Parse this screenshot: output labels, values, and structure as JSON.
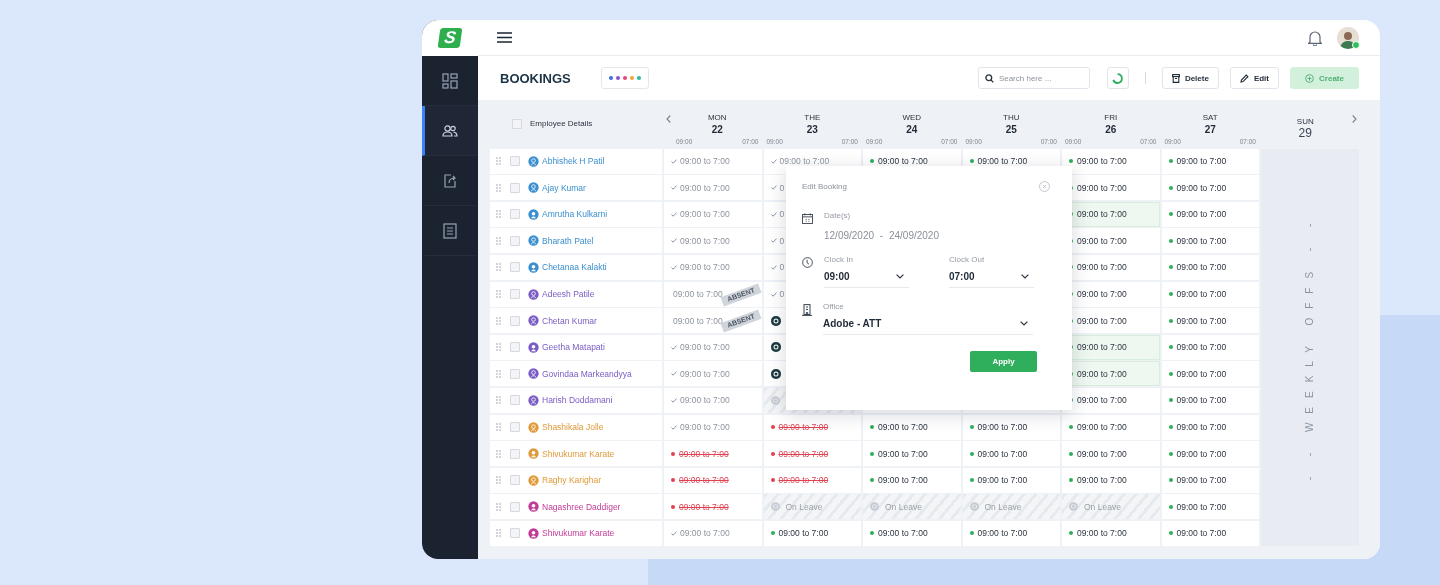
{
  "sidebar": {
    "logo": "S",
    "items": [
      {
        "selected": false
      },
      {
        "selected": true
      },
      {
        "selected": false
      },
      {
        "selected": false
      }
    ]
  },
  "user": {
    "online": true
  },
  "header": {
    "title": "BOOKINGS",
    "color_dots": [
      {
        "color": "#3d6fd8"
      },
      {
        "color": "#8b52d1"
      },
      {
        "color": "#e2487a"
      },
      {
        "color": "#f2a43a"
      },
      {
        "color": "#2cb6a3"
      }
    ],
    "search": {
      "placeholder": "Search here ..."
    },
    "buttons": [
      {
        "kind": "delete",
        "label": "Delete",
        "disabled": false
      },
      {
        "kind": "edit",
        "label": "Edit",
        "disabled": false
      },
      {
        "kind": "create",
        "label": "Create",
        "disabled": true
      }
    ]
  },
  "table": {
    "header": {
      "label": "Employee Details",
      "checked": false
    },
    "days": [
      {
        "name": "MON",
        "date": "22",
        "start": "09:00",
        "end": "07:00",
        "weekly_off": false
      },
      {
        "name": "THE",
        "date": "23",
        "start": "09:00",
        "end": "07:00",
        "weekly_off": false
      },
      {
        "name": "WED",
        "date": "24",
        "start": "09:00",
        "end": "07:00",
        "weekly_off": false
      },
      {
        "name": "THU",
        "date": "25",
        "start": "09:00",
        "end": "07:00",
        "weekly_off": false
      },
      {
        "name": "FRI",
        "date": "26",
        "start": "09:00",
        "end": "07:00",
        "weekly_off": false
      },
      {
        "name": "SAT",
        "date": "27",
        "start": "09:00",
        "end": "07:00",
        "weekly_off": false
      },
      {
        "name": "SUN",
        "date": "29",
        "weekly_off": true
      }
    ],
    "weekly_off_label": "- - WEEKLY OFFS - -",
    "employees": [
      {
        "name": "Abhishek H Patil",
        "color": "#3a8fd0",
        "kind": "outline",
        "checked": false,
        "cells": [
          {
            "kind": "done",
            "text": "09:00 to 7:00",
            "selected": false
          },
          {
            "kind": "done",
            "text": "09:00 to 7:00",
            "selected": false
          },
          {
            "kind": "scheduled",
            "text": "09:00 to 7:00",
            "selected": false
          },
          {
            "kind": "scheduled",
            "text": "09:00 to 7:00",
            "selected": false
          },
          {
            "kind": "scheduled",
            "text": "09:00 to 7:00",
            "selected": false
          },
          {
            "kind": "scheduled",
            "text": "09:00 to 7:00",
            "selected": false
          }
        ]
      },
      {
        "name": "Ajay Kumar",
        "color": "#3a8fd0",
        "kind": "outline",
        "checked": false,
        "cells": [
          {
            "kind": "done",
            "text": "09:00 to 7:00",
            "selected": false
          },
          {
            "kind": "done",
            "text": "0",
            "selected": false
          },
          {
            "kind": "covered"
          },
          {
            "kind": "covered"
          },
          {
            "kind": "scheduled",
            "text": "09:00 to 7:00",
            "selected": false
          },
          {
            "kind": "scheduled",
            "text": "09:00 to 7:00",
            "selected": false
          }
        ]
      },
      {
        "name": "Amrutha Kulkarni",
        "color": "#3a8fd0",
        "kind": "filled",
        "checked": false,
        "cells": [
          {
            "kind": "done",
            "text": "09:00 to 7:00",
            "selected": false
          },
          {
            "kind": "done",
            "text": "0",
            "selected": false
          },
          {
            "kind": "covered"
          },
          {
            "kind": "covered"
          },
          {
            "kind": "scheduled",
            "text": "09:00 to 7:00",
            "selected": true
          },
          {
            "kind": "scheduled",
            "text": "09:00 to 7:00",
            "selected": false
          }
        ]
      },
      {
        "name": "Bharath Patel",
        "color": "#3a8fd0",
        "kind": "outline",
        "checked": false,
        "cells": [
          {
            "kind": "done",
            "text": "09:00 to 7:00",
            "selected": false
          },
          {
            "kind": "done",
            "text": "0",
            "selected": false
          },
          {
            "kind": "covered"
          },
          {
            "kind": "covered"
          },
          {
            "kind": "scheduled",
            "text": "09:00 to 7:00",
            "selected": false
          },
          {
            "kind": "scheduled",
            "text": "09:00 to 7:00",
            "selected": false
          }
        ]
      },
      {
        "name": "Chetanaa Kalakti",
        "color": "#3a8fd0",
        "kind": "filled",
        "checked": false,
        "cells": [
          {
            "kind": "done",
            "text": "09:00 to 7:00",
            "selected": false
          },
          {
            "kind": "done",
            "text": "0",
            "selected": false
          },
          {
            "kind": "covered"
          },
          {
            "kind": "covered"
          },
          {
            "kind": "scheduled",
            "text": "09:00 to 7:00",
            "selected": false
          },
          {
            "kind": "scheduled",
            "text": "09:00 to 7:00",
            "selected": false
          }
        ]
      },
      {
        "name": "Adeesh Patile",
        "color": "#7b5cc6",
        "kind": "outline",
        "checked": false,
        "cells": [
          {
            "kind": "absent",
            "text": "09:00 to 7:00",
            "tag": "ABSENT",
            "selected": false
          },
          {
            "kind": "done",
            "text": "0",
            "selected": false
          },
          {
            "kind": "covered"
          },
          {
            "kind": "covered"
          },
          {
            "kind": "scheduled",
            "text": "09:00 to 7:00",
            "selected": false
          },
          {
            "kind": "scheduled",
            "text": "09:00 to 7:00",
            "selected": false
          }
        ]
      },
      {
        "name": "Chetan Kumar",
        "color": "#7b5cc6",
        "kind": "outline",
        "checked": false,
        "cells": [
          {
            "kind": "absent",
            "text": "09:00 to 7:00",
            "tag": "ABSENT",
            "selected": false
          },
          {
            "kind": "office",
            "selected": false
          },
          {
            "kind": "covered"
          },
          {
            "kind": "covered"
          },
          {
            "kind": "scheduled",
            "text": "09:00 to 7:00",
            "selected": false
          },
          {
            "kind": "scheduled",
            "text": "09:00 to 7:00",
            "selected": false
          }
        ]
      },
      {
        "name": "Geetha Matapati",
        "color": "#7b5cc6",
        "kind": "filled",
        "checked": false,
        "cells": [
          {
            "kind": "done",
            "text": "09:00 to 7:00",
            "selected": false
          },
          {
            "kind": "office",
            "selected": false
          },
          {
            "kind": "covered"
          },
          {
            "kind": "covered"
          },
          {
            "kind": "scheduled",
            "text": "09:00 to 7:00",
            "selected": true
          },
          {
            "kind": "scheduled",
            "text": "09:00 to 7:00",
            "selected": false
          }
        ]
      },
      {
        "name": "Govindaa Markeandyya",
        "color": "#7b5cc6",
        "kind": "outline",
        "checked": false,
        "cells": [
          {
            "kind": "done",
            "text": "09:00 to 7:00",
            "selected": false
          },
          {
            "kind": "office",
            "selected": false
          },
          {
            "kind": "covered"
          },
          {
            "kind": "covered"
          },
          {
            "kind": "scheduled",
            "text": "09:00 to 7:00",
            "selected": true
          },
          {
            "kind": "scheduled",
            "text": "09:00 to 7:00",
            "selected": false
          }
        ]
      },
      {
        "name": "Harish Doddamani",
        "color": "#7b5cc6",
        "kind": "outline",
        "checked": false,
        "cells": [
          {
            "kind": "done",
            "text": "09:00 to 7:00",
            "selected": false
          },
          {
            "kind": "leave",
            "selected": false
          },
          {
            "kind": "covered"
          },
          {
            "kind": "covered"
          },
          {
            "kind": "scheduled",
            "text": "09:00 to 7:00",
            "selected": false
          },
          {
            "kind": "scheduled",
            "text": "09:00 to 7:00",
            "selected": false
          }
        ]
      },
      {
        "name": "Shashikala Jolle",
        "color": "#e09a3a",
        "kind": "outline",
        "checked": false,
        "cells": [
          {
            "kind": "done",
            "text": "09:00 to 7:00",
            "selected": false
          },
          {
            "kind": "cancelled",
            "text": "09:00 to 7:00",
            "selected": false
          },
          {
            "kind": "scheduled",
            "text": "09:00 to 7:00",
            "selected": false
          },
          {
            "kind": "scheduled",
            "text": "09:00 to 7:00",
            "selected": false
          },
          {
            "kind": "scheduled",
            "text": "09:00 to 7:00",
            "selected": false
          },
          {
            "kind": "scheduled",
            "text": "09:00 to 7:00",
            "selected": false
          }
        ]
      },
      {
        "name": "Shivukumar Karate",
        "color": "#e09a3a",
        "kind": "filled",
        "checked": false,
        "cells": [
          {
            "kind": "cancelled",
            "text": "09:00 to 7:00",
            "selected": false
          },
          {
            "kind": "cancelled",
            "text": "09:00 to 7:00",
            "selected": false
          },
          {
            "kind": "scheduled",
            "text": "09:00 to 7:00",
            "selected": false
          },
          {
            "kind": "scheduled",
            "text": "09:00 to 7:00",
            "selected": false
          },
          {
            "kind": "scheduled",
            "text": "09:00 to 7:00",
            "selected": false
          },
          {
            "kind": "scheduled",
            "text": "09:00 to 7:00",
            "selected": false
          }
        ]
      },
      {
        "name": "Raghy Karighar",
        "color": "#e09a3a",
        "kind": "outline",
        "checked": false,
        "cells": [
          {
            "kind": "cancelled",
            "text": "09:00 to 7:00",
            "selected": false
          },
          {
            "kind": "cancelled",
            "text": "09:00 to 7:00",
            "selected": false
          },
          {
            "kind": "scheduled",
            "text": "09:00 to 7:00",
            "selected": false
          },
          {
            "kind": "scheduled",
            "text": "09:00 to 7:00",
            "selected": false
          },
          {
            "kind": "scheduled",
            "text": "09:00 to 7:00",
            "selected": false
          },
          {
            "kind": "scheduled",
            "text": "09:00 to 7:00",
            "selected": false
          }
        ]
      },
      {
        "name": "Nagashree Daddiger",
        "color": "#c23b98",
        "kind": "filled",
        "checked": false,
        "cells": [
          {
            "kind": "cancelled",
            "text": "09:00 to 7:00",
            "selected": false
          },
          {
            "kind": "leave",
            "text": "On Leave",
            "selected": false
          },
          {
            "kind": "leave",
            "text": "On Leave",
            "selected": false
          },
          {
            "kind": "leave",
            "text": "On Leave",
            "selected": false
          },
          {
            "kind": "leave",
            "text": "On Leave",
            "selected": false
          },
          {
            "kind": "scheduled",
            "text": "09:00 to 7:00",
            "selected": false
          }
        ]
      },
      {
        "name": "Shivukumar Karate",
        "color": "#c23b98",
        "kind": "filled",
        "checked": false,
        "cells": [
          {
            "kind": "done",
            "text": "09:00 to 7:00",
            "selected": false
          },
          {
            "kind": "scheduled",
            "text": "09:00 to 7:00",
            "selected": false
          },
          {
            "kind": "scheduled",
            "text": "09:00 to 7:00",
            "selected": false
          },
          {
            "kind": "scheduled",
            "text": "09:00 to 7:00",
            "selected": false
          },
          {
            "kind": "scheduled",
            "text": "09:00 to 7:00",
            "selected": false
          },
          {
            "kind": "scheduled",
            "text": "09:00 to 7:00",
            "selected": false
          }
        ]
      }
    ]
  },
  "dialog": {
    "title": "Edit Booking",
    "dates": {
      "label": "Date(s)",
      "value": "12/09/2020 - 24/09/2020"
    },
    "clock_in": {
      "label": "Clock In",
      "value": "09:00"
    },
    "clock_out": {
      "label": "Clock Out",
      "value": "07:00"
    },
    "office": {
      "label": "Office",
      "value": "Adobe - ATT"
    },
    "apply": "Apply"
  }
}
